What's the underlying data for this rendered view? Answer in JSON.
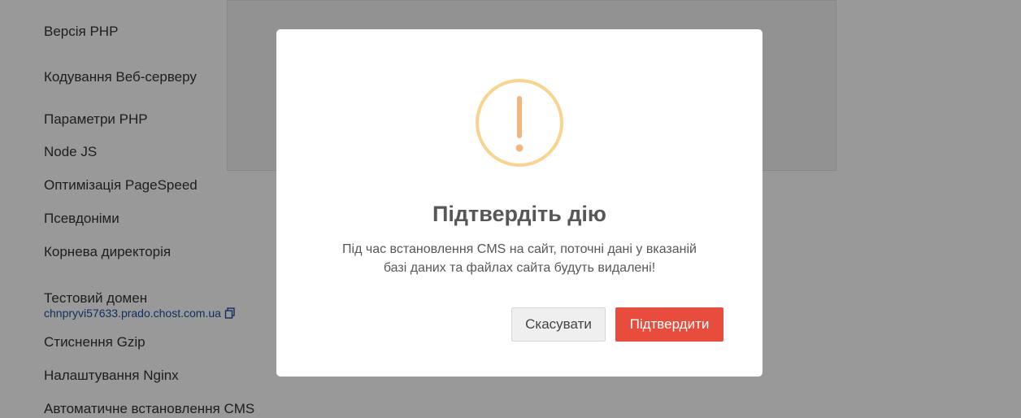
{
  "sidebar": {
    "items": [
      {
        "id": "php-version",
        "label": "Версія PHP"
      },
      {
        "id": "webserver-encoding",
        "label": "Кодування Веб-серверу"
      },
      {
        "id": "php-params",
        "label": "Параметри PHP"
      },
      {
        "id": "node-js",
        "label": "Node JS"
      },
      {
        "id": "pagespeed",
        "label": "Оптимізація PageSpeed"
      },
      {
        "id": "aliases",
        "label": "Псевдоніми"
      },
      {
        "id": "root-dir",
        "label": "Корнева директорія"
      },
      {
        "id": "test-domain",
        "label": "Тестовий домен"
      },
      {
        "id": "gzip",
        "label": "Стиснення Gzip"
      },
      {
        "id": "nginx",
        "label": "Налаштування Nginx"
      },
      {
        "id": "cms-autoinstall",
        "label": "Автоматичне встановлення CMS"
      }
    ],
    "test_domain_value": "chnpryvi57633.prado.chost.com.ua",
    "copy_icon": "copy-icon"
  },
  "modal": {
    "icon": "exclamation-circle-icon",
    "icon_color": "#f8d48e",
    "title": "Підтвердіть дію",
    "text_line1": "Під час встановлення CMS на сайт, поточні дані у вказаній",
    "text_line2": "базі даних та файлах сайта будуть видалені!",
    "cancel_label": "Скасувати",
    "confirm_label": "Підтвердити",
    "confirm_color": "#e74c3c"
  }
}
